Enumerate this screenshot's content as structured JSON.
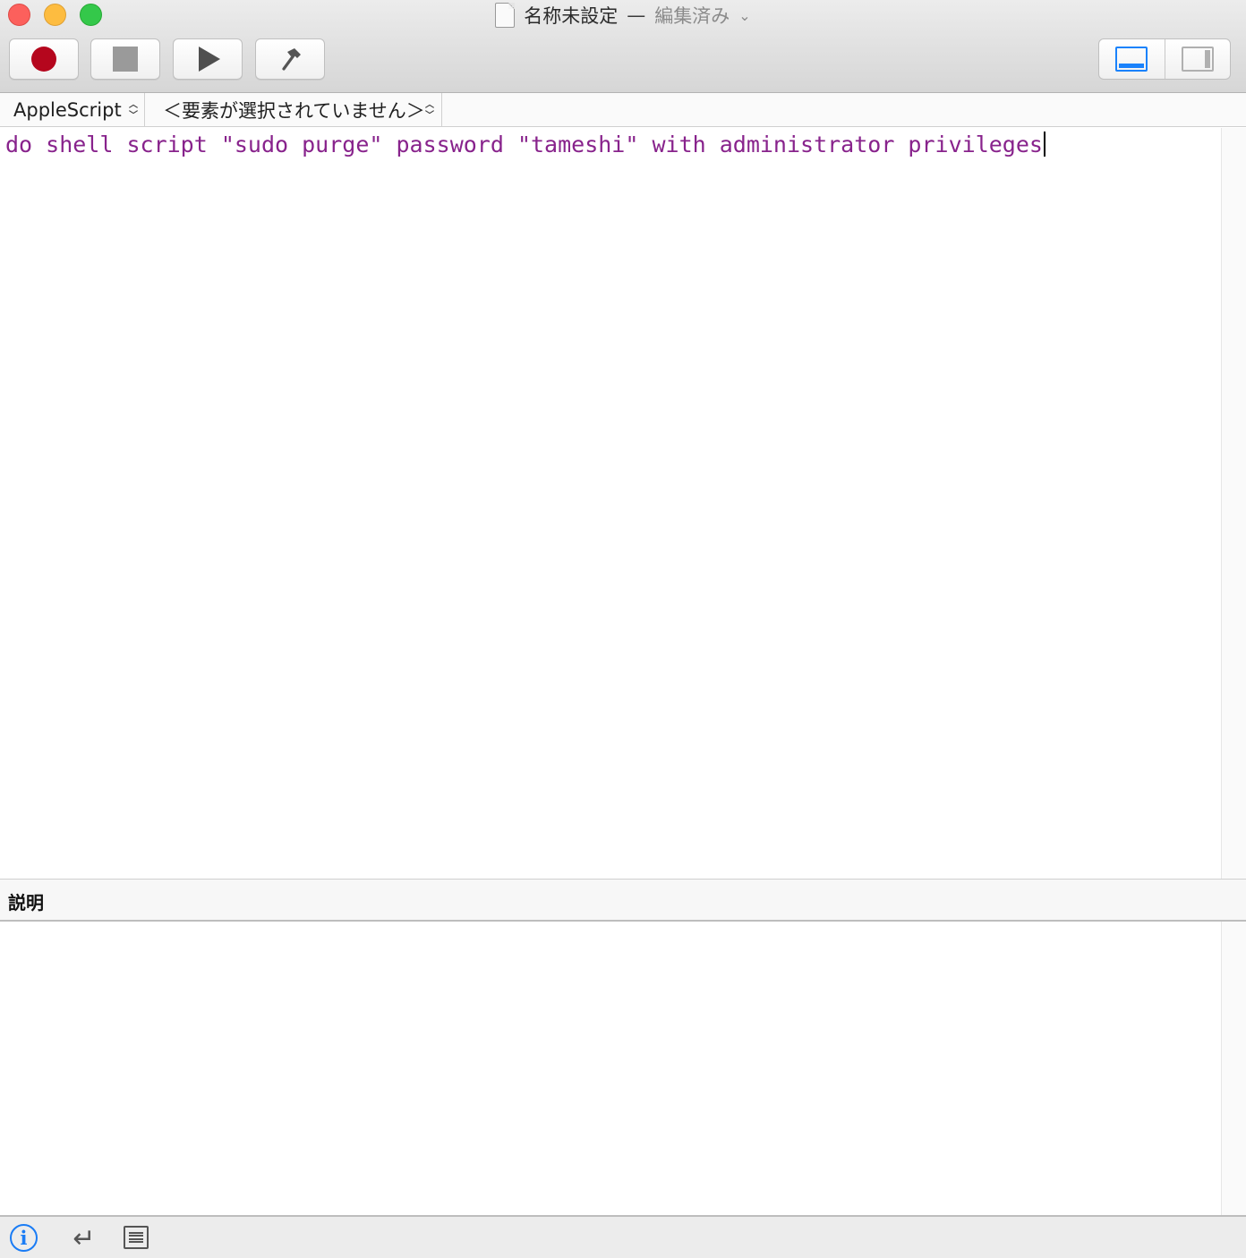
{
  "window": {
    "title": "名称未設定",
    "separator": "—",
    "edited_label": "編集済み",
    "title_menu_chevron": "⌄"
  },
  "toolbar": {
    "buttons": [
      {
        "name": "record",
        "icon": "record-icon"
      },
      {
        "name": "stop",
        "icon": "stop-icon"
      },
      {
        "name": "run",
        "icon": "play-icon"
      },
      {
        "name": "compile",
        "icon": "hammer-icon"
      }
    ],
    "view_toggle": [
      {
        "name": "show-bottom-pane",
        "icon": "bottom-pane-icon",
        "selected": true
      },
      {
        "name": "show-side-pane",
        "icon": "side-pane-icon",
        "selected": false
      }
    ]
  },
  "navigation": {
    "language": "AppleScript",
    "element": "＜要素が選択されていません＞"
  },
  "editor": {
    "code": "do shell script \"sudo purge\" password \"tameshi\" with administrator privileges",
    "code_color": "#88238c"
  },
  "description_pane": {
    "header": "説明",
    "content": ""
  },
  "bottom_bar": {
    "icons": [
      "info-icon",
      "return-icon",
      "list-icon"
    ]
  },
  "colors": {
    "record": "#b5061d",
    "accent": "#1a82fb"
  }
}
